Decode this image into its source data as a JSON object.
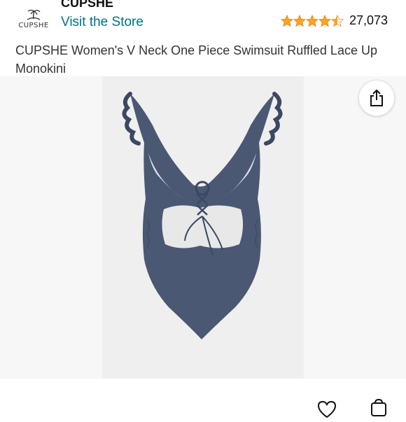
{
  "header": {
    "logo_text": "CUPSHE",
    "brand_name": "CUPSHE",
    "visit_store_label": "Visit the Store",
    "rating": 4.5,
    "rating_count": "27,073",
    "star_color": "#ffa41c"
  },
  "product": {
    "title": "CUPSHE Women's V Neck One Piece Swimsuit Ruffled Lace Up Monokini",
    "swimsuit_color": "#4a5873"
  },
  "icons": {
    "share": "share-icon",
    "heart": "heart-icon",
    "cart": "cart-icon",
    "logo": "palm-tree-icon"
  },
  "colors": {
    "link": "#007185",
    "background": "#ffffff",
    "image_bg": "#f7f7f7"
  }
}
